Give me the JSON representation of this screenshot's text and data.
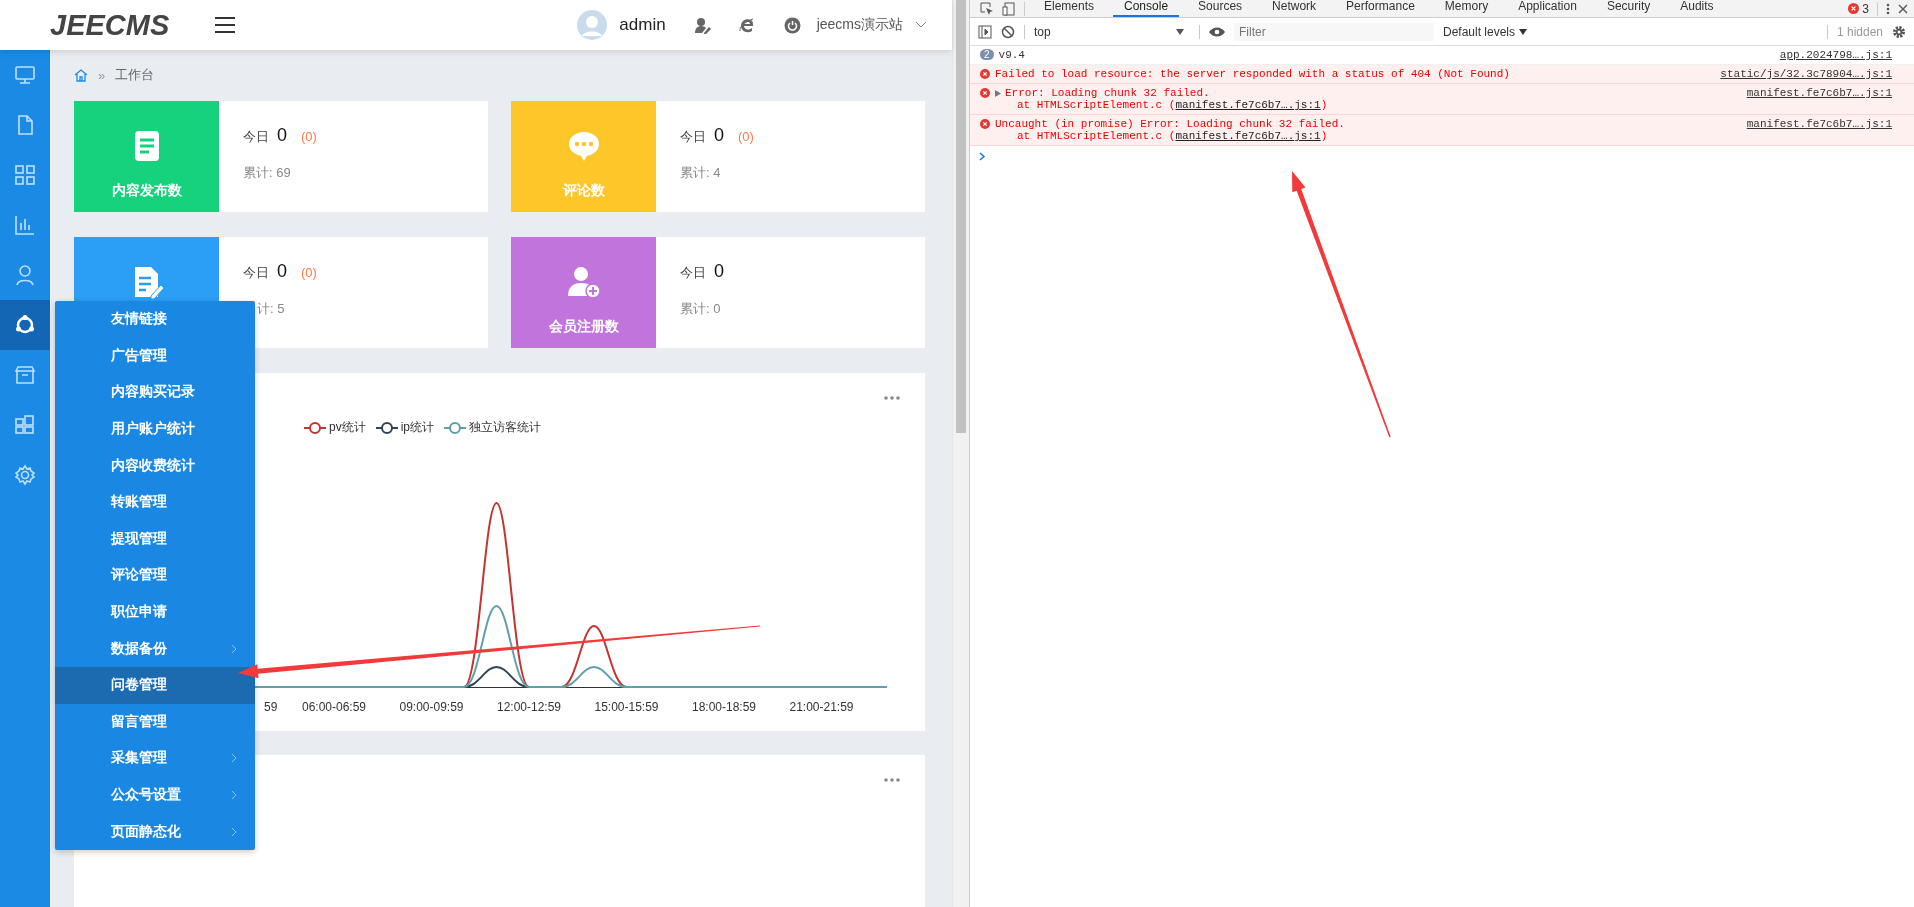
{
  "header": {
    "logo": "JEECMS",
    "user": "admin",
    "site": "jeecms演示站"
  },
  "sidebar": {
    "items": [
      {
        "selected": false
      },
      {
        "selected": false
      },
      {
        "selected": false
      },
      {
        "selected": false
      },
      {
        "selected": false
      },
      {
        "selected": true
      },
      {
        "selected": false
      },
      {
        "selected": false
      },
      {
        "selected": false
      }
    ]
  },
  "breadcrumb": {
    "separator": "»",
    "current": "工作台"
  },
  "cards": [
    {
      "kind": "content",
      "color": "#17d27d",
      "label": "内容发布数",
      "today_label": "今日",
      "today": "0",
      "today_delta": "(0)",
      "total": "累计: 69"
    },
    {
      "kind": "comment",
      "color": "#fdc72a",
      "label": "评论数",
      "today_label": "今日",
      "today": "0",
      "today_delta": "(0)",
      "total": "累计: 4"
    },
    {
      "kind": "article",
      "color": "#2b9ff5",
      "today_label": "今日",
      "today": "0",
      "today_delta": "(0)",
      "total": "计: 5"
    },
    {
      "kind": "member",
      "color": "#c074dc",
      "label": "会员注册数",
      "today_label": "今日",
      "today": "0",
      "total": "累计: 0"
    }
  ],
  "chart": {
    "legend": [
      {
        "name": "pv统计",
        "color": "#c23531"
      },
      {
        "name": "ip统计",
        "color": "#2f4554"
      },
      {
        "name": "独立访客统计",
        "color": "#61a0a8"
      }
    ],
    "x_labels": [
      "59",
      "06:00-06:59",
      "09:00-09:59",
      "12:00-12:59",
      "15:00-15:59",
      "18:00-18:59",
      "21:00-21:59"
    ]
  },
  "flyout_menu": {
    "items": [
      {
        "label": "友情链接",
        "has_children": false,
        "selected": false
      },
      {
        "label": "广告管理",
        "has_children": false,
        "selected": false
      },
      {
        "label": "内容购买记录",
        "has_children": false,
        "selected": false
      },
      {
        "label": "用户账户统计",
        "has_children": false,
        "selected": false
      },
      {
        "label": "内容收费统计",
        "has_children": false,
        "selected": false
      },
      {
        "label": "转账管理",
        "has_children": false,
        "selected": false
      },
      {
        "label": "提现管理",
        "has_children": false,
        "selected": false
      },
      {
        "label": "评论管理",
        "has_children": false,
        "selected": false
      },
      {
        "label": "职位申请",
        "has_children": false,
        "selected": false
      },
      {
        "label": "数据备份",
        "has_children": true,
        "selected": false
      },
      {
        "label": "问卷管理",
        "has_children": false,
        "selected": true
      },
      {
        "label": "留言管理",
        "has_children": false,
        "selected": false
      },
      {
        "label": "采集管理",
        "has_children": true,
        "selected": false
      },
      {
        "label": "公众号设置",
        "has_children": true,
        "selected": false
      },
      {
        "label": "页面静态化",
        "has_children": true,
        "selected": false
      }
    ]
  },
  "devtools": {
    "tabs": [
      {
        "label": "Elements",
        "selected": false
      },
      {
        "label": "Console",
        "selected": true
      },
      {
        "label": "Sources",
        "selected": false
      },
      {
        "label": "Network",
        "selected": false
      },
      {
        "label": "Performance",
        "selected": false
      },
      {
        "label": "Memory",
        "selected": false
      },
      {
        "label": "Application",
        "selected": false
      },
      {
        "label": "Security",
        "selected": false
      },
      {
        "label": "Audits",
        "selected": false
      }
    ],
    "error_count": "3",
    "context": "top",
    "filter_placeholder": "Filter",
    "levels": "Default levels",
    "hidden": "1 hidden",
    "messages": [
      {
        "kind": "info",
        "count": "2",
        "text": "v9.4",
        "source": "app.2024798….js:1"
      },
      {
        "kind": "error",
        "expandable": false,
        "text": "Failed to load resource: the server responded with a status of 404 (Not Found)",
        "source": "static/js/32.3c78904….js:1"
      },
      {
        "kind": "error",
        "expandable": true,
        "text": "Error: Loading chunk 32 failed.",
        "trace": "at HTMLScriptElement.c (",
        "trace_link": "manifest.fe7c6b7….js:1",
        "trace_end": ")",
        "source": "manifest.fe7c6b7….js:1"
      },
      {
        "kind": "error",
        "expandable": false,
        "text": "Uncaught (in promise) Error: Loading chunk 32 failed.",
        "trace": "at HTMLScriptElement.c (",
        "trace_link": "manifest.fe7c6b7….js:1",
        "trace_end": ")",
        "source": "manifest.fe7c6b7….js:1"
      }
    ]
  }
}
